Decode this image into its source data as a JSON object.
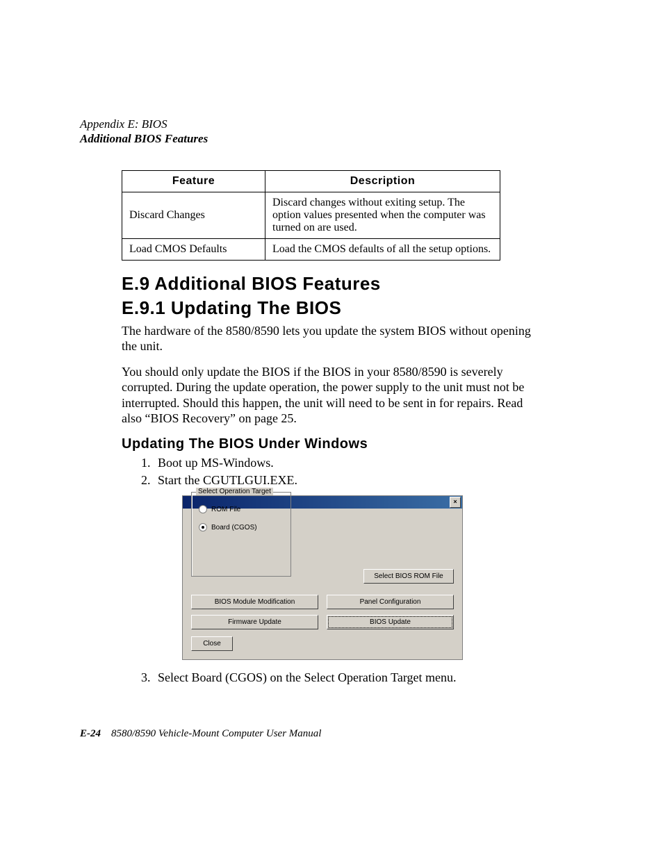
{
  "header": {
    "line1": "Appendix E: BIOS",
    "line2": "Additional BIOS Features"
  },
  "table": {
    "head_feature": "Feature",
    "head_description": "Description",
    "rows": [
      {
        "feature": "Discard Changes",
        "description": "Discard changes without exiting setup. The option values presented when the computer was turned on are used."
      },
      {
        "feature": "Load CMOS Defaults",
        "description": "Load the CMOS defaults of all the setup options."
      }
    ]
  },
  "headings": {
    "e9": "E.9   Additional BIOS Features",
    "e91": "E.9.1   Updating The BIOS",
    "sub": "Updating The BIOS Under Windows"
  },
  "paragraphs": {
    "p1": "The hardware of the 8580/8590 lets you update the system BIOS without opening the unit.",
    "p2": "You should only update the BIOS if the BIOS in your 8580/8590 is severely corrupted. During the update operation, the power supply to the unit must not be interrupted. Should this happen, the unit will need to be sent in for repairs. Read also “BIOS Recovery” on page 25."
  },
  "steps": {
    "s1": "Boot up MS-Windows.",
    "s2": "Start the CGUTLGUI.EXE.",
    "s3": "Select Board (CGOS) on the Select Operation Target menu."
  },
  "dialog": {
    "close_x": "×",
    "fieldset_legend": "Select Operation Target",
    "radio_rom": "ROM File",
    "radio_board": "Board (CGOS)",
    "btn_select_rom": "Select BIOS ROM File",
    "btn_mod": "BIOS Module Modification",
    "btn_panel": "Panel Configuration",
    "btn_fw": "Firmware Update",
    "btn_bios": "BIOS Update",
    "btn_close": "Close"
  },
  "footer": {
    "page": "E-24",
    "title": "8580/8590 Vehicle-Mount Computer User Manual"
  }
}
